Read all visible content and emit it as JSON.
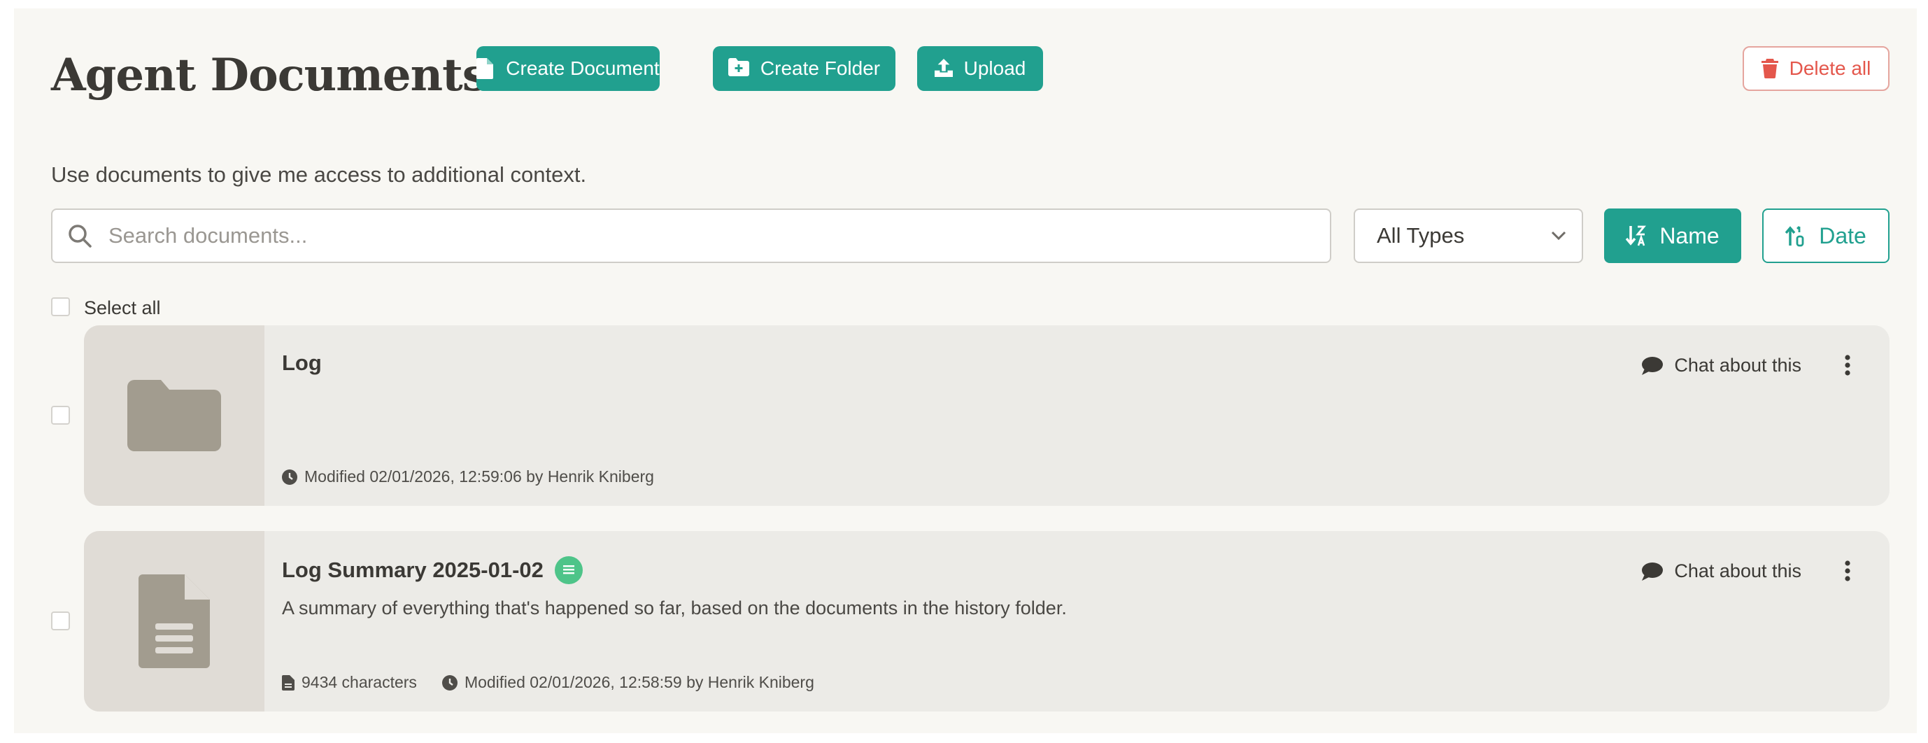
{
  "header": {
    "title": "Agent Documents",
    "create_document_label": "Create Document",
    "create_folder_label": "Create Folder",
    "upload_label": "Upload",
    "delete_all_label": "Delete all"
  },
  "subtitle": "Use documents to give me access to additional context.",
  "search": {
    "placeholder": "Search documents...",
    "value": ""
  },
  "filter": {
    "selected": "All Types"
  },
  "sort": {
    "name_label": "Name",
    "date_label": "Date",
    "active": "Name"
  },
  "select_all_label": "Select all",
  "documents": [
    {
      "type": "folder",
      "name": "Log",
      "description": "",
      "modified": "Modified 02/01/2026, 12:59:06 by Henrik Kniberg",
      "chat_label": "Chat about this"
    },
    {
      "type": "document",
      "name": "Log Summary 2025-01-02",
      "description": "A summary of everything that's happened so far, based on the documents in the history folder.",
      "characters": "9434 characters",
      "modified": "Modified 02/01/2026, 12:58:59 by Henrik Kniberg",
      "chat_label": "Chat about this"
    }
  ],
  "colors": {
    "accent": "#21a08f",
    "danger": "#e4574c",
    "badge": "#4ec489",
    "background": "#f8f7f3",
    "card": "#ecebe7"
  },
  "icons": {
    "create_document": "document-icon",
    "create_folder": "folder-plus-icon",
    "upload": "upload-icon",
    "delete_all": "trash-icon",
    "search": "search-icon",
    "filter": "chevron-down-icon",
    "sort_name": "sort-alpha-icon",
    "sort_date": "sort-date-icon",
    "chat": "chat-bubble-icon",
    "more": "more-vertical-icon",
    "modified": "clock-icon",
    "characters": "file-icon",
    "text_badge": "text-lines-icon"
  }
}
